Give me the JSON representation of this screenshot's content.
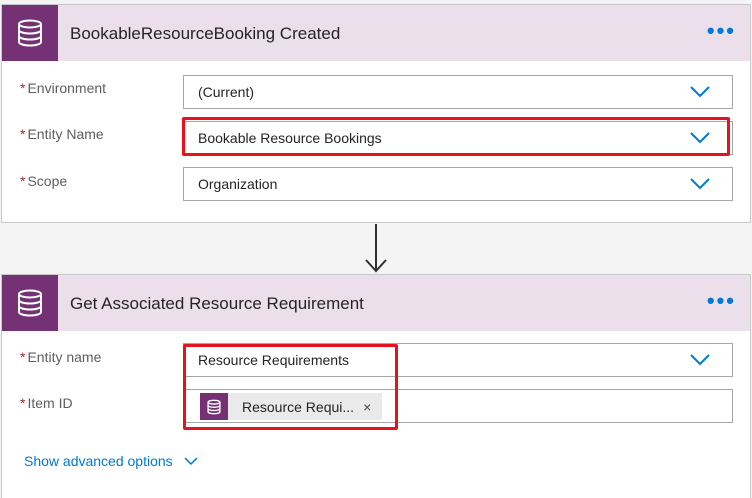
{
  "colors": {
    "header_bg": "#ebdfeb",
    "connector_purple": "#743274",
    "accent_blue": "#0078d4",
    "highlight_red": "#e8111e",
    "required_red": "#a4262c"
  },
  "trigger": {
    "icon": "database-icon",
    "title": "BookableResourceBooking Created",
    "more_label": "•••",
    "fields": [
      {
        "label": "Environment",
        "required_marker": "*",
        "value": "(Current)"
      },
      {
        "label": "Entity Name",
        "required_marker": "*",
        "value": "Bookable Resource Bookings"
      },
      {
        "label": "Scope",
        "required_marker": "*",
        "value": "Organization"
      }
    ]
  },
  "action": {
    "icon": "database-icon",
    "title": "Get Associated Resource Requirement",
    "more_label": "•••",
    "entity_field": {
      "label": "Entity name",
      "required_marker": "*",
      "value": "Resource Requirements"
    },
    "item_field": {
      "label": "Item ID",
      "required_marker": "*",
      "token": {
        "icon": "database-icon",
        "label": "Resource Requi...",
        "close": "×"
      }
    },
    "advanced_label": "Show advanced options"
  }
}
